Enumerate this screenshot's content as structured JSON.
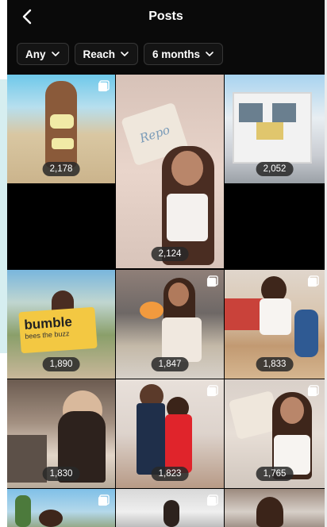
{
  "header": {
    "title": "Posts",
    "back_icon": "chevron-left-icon"
  },
  "filters": [
    {
      "label": "Any"
    },
    {
      "label": "Reach"
    },
    {
      "label": "6 months"
    }
  ],
  "posts": [
    {
      "reach": "2,178",
      "multi": true
    },
    {
      "reach": "2,124",
      "multi": false
    },
    {
      "reach": "2,052",
      "multi": false
    },
    {
      "reach": "1,890",
      "multi": false
    },
    {
      "reach": "1,847",
      "multi": true
    },
    {
      "reach": "1,833",
      "multi": true
    },
    {
      "reach": "1,830",
      "multi": false
    },
    {
      "reach": "1,823",
      "multi": true
    },
    {
      "reach": "1,765",
      "multi": true
    },
    {
      "reach": "",
      "multi": true
    },
    {
      "reach": "",
      "multi": true
    },
    {
      "reach": "",
      "multi": false
    }
  ],
  "image_text": {
    "sign_brand": "bumble",
    "sign_tagline": "bees the buzz",
    "box_brand": "Repo"
  }
}
